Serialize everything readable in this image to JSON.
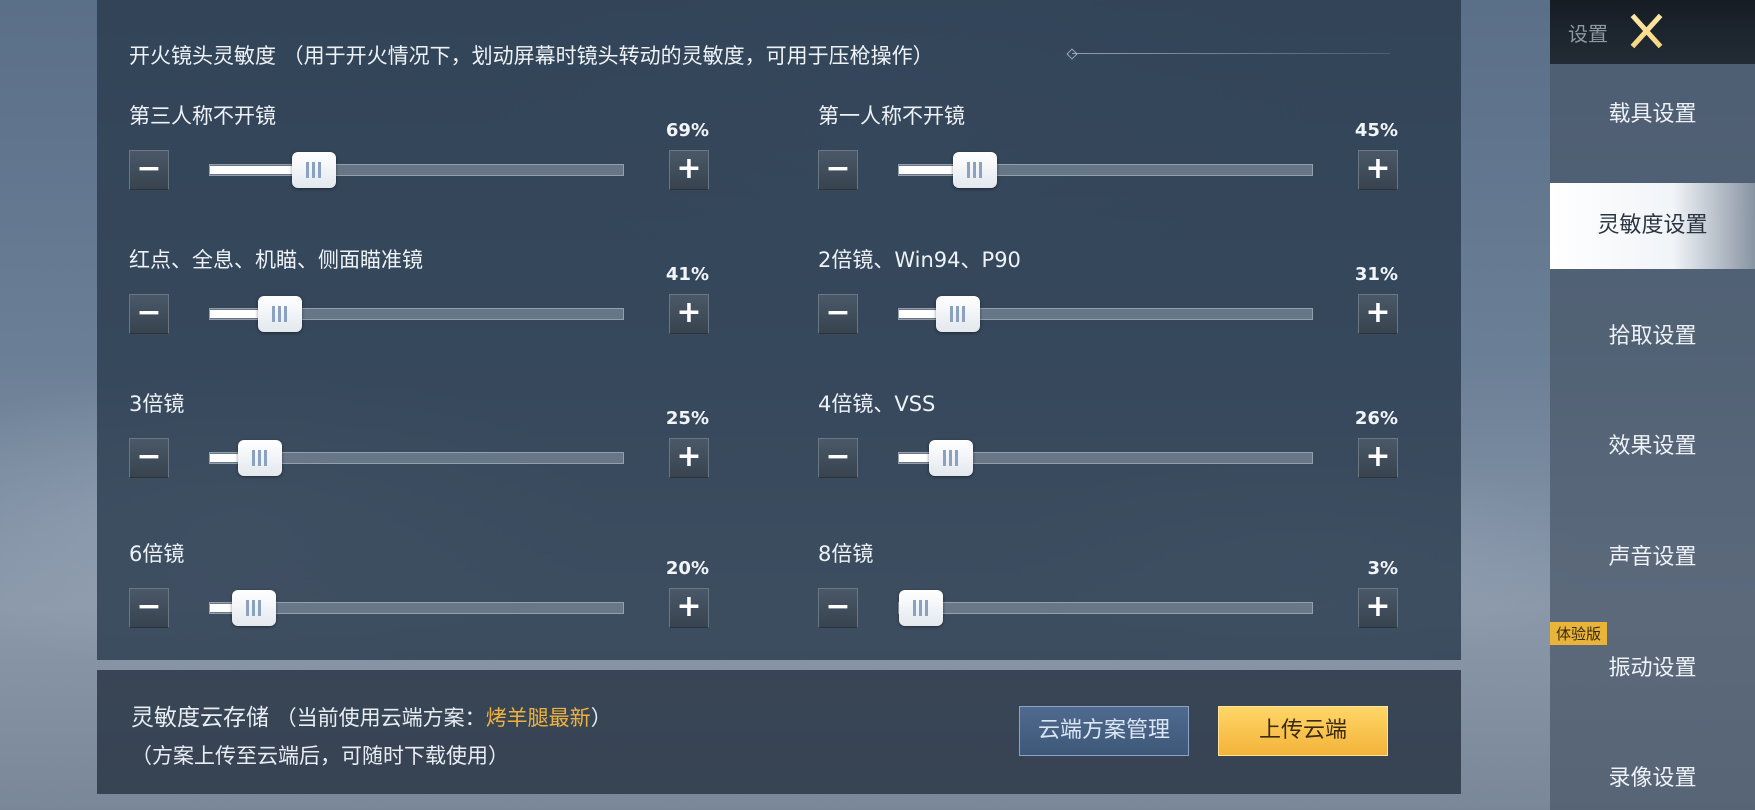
{
  "section": {
    "title": "开火镜头灵敏度 （用于开火情况下，划动屏幕时镜头转动的灵敏度，可用于压枪操作）"
  },
  "controls": {
    "minus": "−",
    "plus": "+"
  },
  "sliders": [
    {
      "label": "第三人称不开镜",
      "value_text": "69%",
      "value": 0.22
    },
    {
      "label": "第一人称不开镜",
      "value_text": "45%",
      "value": 0.145
    },
    {
      "label": "红点、全息、机瞄、侧面瞄准镜",
      "value_text": "41%",
      "value": 0.13
    },
    {
      "label": "2倍镜、Win94、P90",
      "value_text": "31%",
      "value": 0.1
    },
    {
      "label": "3倍镜",
      "value_text": "25%",
      "value": 0.075
    },
    {
      "label": "4倍镜、VSS",
      "value_text": "26%",
      "value": 0.08
    },
    {
      "label": "6倍镜",
      "value_text": "20%",
      "value": 0.06
    },
    {
      "label": "8倍镜",
      "value_text": "3%",
      "value": 0.0
    }
  ],
  "cloud": {
    "title": "灵敏度云存储",
    "current_prefix": " （当前使用云端方案：",
    "current_scheme": "烤羊腿最新",
    "current_suffix": "）",
    "note": "（方案上传至云端后，可随时下载使用）",
    "manage_button": "云端方案管理",
    "upload_button": "上传云端"
  },
  "sidebar": {
    "header": "设置",
    "items": [
      {
        "label": "载具设置",
        "active": false
      },
      {
        "label": "灵敏度设置",
        "active": true
      },
      {
        "label": "拾取设置",
        "active": false
      },
      {
        "label": "效果设置",
        "active": false
      },
      {
        "label": "声音设置",
        "active": false
      },
      {
        "label": "振动设置",
        "active": false
      },
      {
        "label": "录像设置",
        "active": false
      }
    ],
    "badge": "体验版"
  },
  "colors": {
    "accent_gold": "#f0b23c",
    "panel_bg": "#28384c",
    "active_tab_bg": "#ffffff"
  }
}
